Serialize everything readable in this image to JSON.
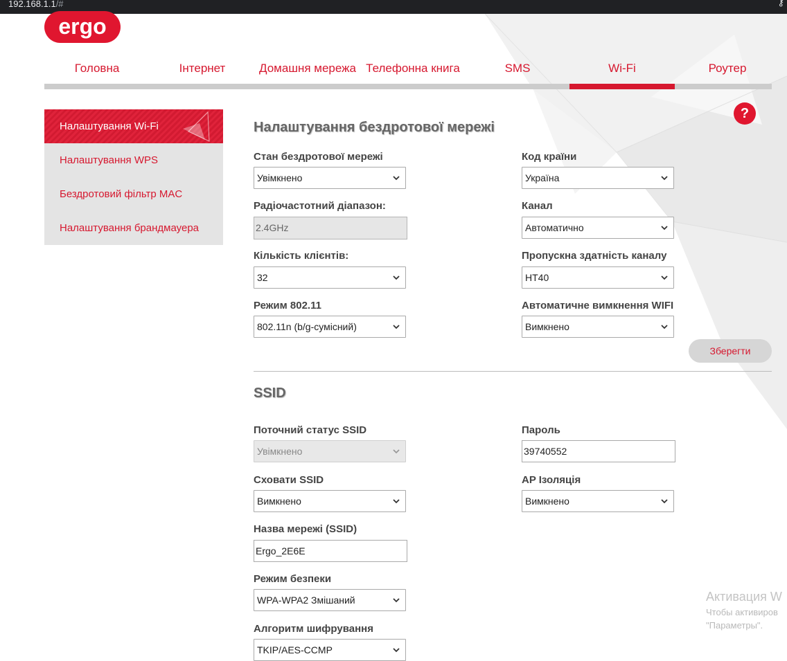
{
  "browser": {
    "url_host": "192.168.1.1",
    "url_path": "/#"
  },
  "brand": {
    "logo_text": "ergo",
    "accent_color": "#d6182f"
  },
  "nav": {
    "items": [
      {
        "label": "Головна"
      },
      {
        "label": "Інтернет"
      },
      {
        "label": "Домашня мережа"
      },
      {
        "label": "Телефонна книга"
      },
      {
        "label": "SMS"
      },
      {
        "label": "Wi-Fi",
        "active": true
      },
      {
        "label": "Роутер"
      }
    ]
  },
  "sidebar": {
    "items": [
      {
        "label": "Налаштування Wi-Fi",
        "active": true
      },
      {
        "label": "Налаштування WPS"
      },
      {
        "label": "Бездротовий фільтр MAC"
      },
      {
        "label": "Налаштування брандмауера"
      }
    ]
  },
  "help_icon": {
    "glyph": "?"
  },
  "wireless": {
    "title": "Налаштування бездротової мережі",
    "state": {
      "label": "Стан бездротової мережі",
      "value": "Увімкнено"
    },
    "band": {
      "label": "Радіочастотний діапазон:",
      "value": "2.4GHz"
    },
    "clients": {
      "label": "Кількість клієнтів:",
      "value": "32"
    },
    "mode": {
      "label": "Режим 802.11",
      "value": "802.11n (b/g-сумісний)"
    },
    "country": {
      "label": "Код країни",
      "value": "Україна"
    },
    "channel": {
      "label": "Канал",
      "value": "Автоматично"
    },
    "bandwidth": {
      "label": "Пропускна здатність каналу",
      "value": "HT40"
    },
    "auto_off": {
      "label": "Автоматичне вимкнення WIFI",
      "value": "Вимкнено"
    },
    "save_label": "Зберегти"
  },
  "ssid": {
    "title": "SSID",
    "status": {
      "label": "Поточний статус SSID",
      "value": "Увімкнено"
    },
    "hide": {
      "label": "Сховати SSID",
      "value": "Вимкнено"
    },
    "name": {
      "label": "Назва мережі (SSID)",
      "value": "Ergo_2E6E"
    },
    "security": {
      "label": "Режим безпеки",
      "value": "WPA-WPA2 Змішаний"
    },
    "encryption": {
      "label": "Алгоритм шифрування",
      "value": "TKIP/AES-CCMP"
    },
    "password": {
      "label": "Пароль",
      "value": "39740552"
    },
    "ap_isolation": {
      "label": "AP Ізоляція",
      "value": "Вимкнено"
    }
  },
  "os_watermark": {
    "line1": "Активация W",
    "line2": "Чтобы активиров",
    "line3": "\"Параметры\"."
  }
}
